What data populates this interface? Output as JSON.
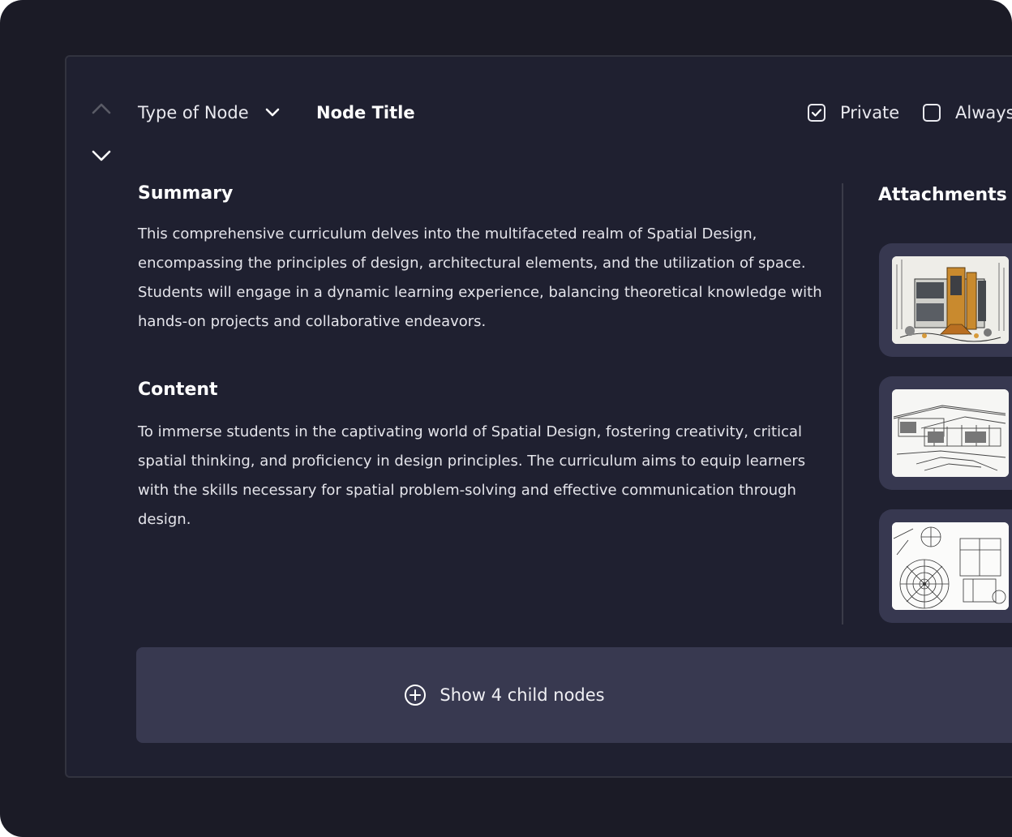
{
  "header": {
    "type_select_label": "Type of Node",
    "node_title": "Node Title",
    "private_label": "Private",
    "private_checked": true,
    "always_label": "Always",
    "always_checked": false
  },
  "summary": {
    "title": "Summary",
    "text": "This comprehensive curriculum delves into the multifaceted realm of Spatial Design, encompassing the principles of design, architectural elements, and the utilization of space. Students will engage in a dynamic learning experience, balancing theoretical knowledge with hands-on projects and collaborative endeavors."
  },
  "content": {
    "title": "Content",
    "text": "To immerse students in the captivating world of Spatial Design, fostering creativity, critical spatial thinking, and proficiency in design principles. The curriculum aims to equip learners with the skills necessary for spatial problem-solving and effective communication through design."
  },
  "attachments": {
    "title": "Attachments",
    "items": [
      {
        "icon": "modern-house-sketch-colored"
      },
      {
        "icon": "house-architecture-sketch"
      },
      {
        "icon": "floor-plan-drawing"
      }
    ]
  },
  "children": {
    "label": "Show 4 child nodes"
  },
  "colors": {
    "background": "#1b1b26",
    "card": "#1f2030",
    "accent_panel": "#383950",
    "text": "#e9e9ef"
  }
}
